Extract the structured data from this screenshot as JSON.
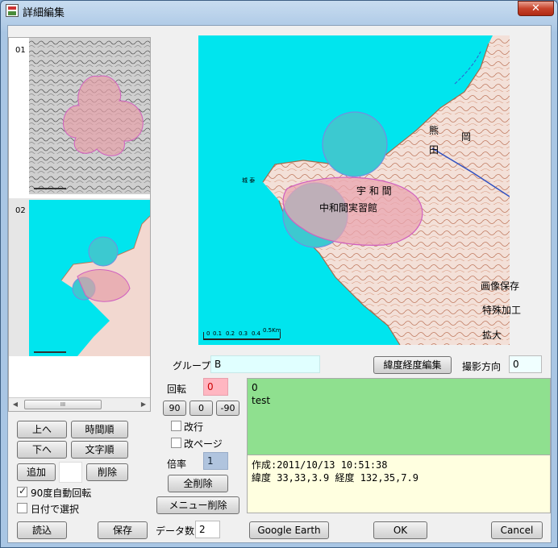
{
  "window": {
    "title": "詳細編集",
    "close_label": "✕"
  },
  "thumbnails": [
    {
      "number": "01"
    },
    {
      "number": "02"
    }
  ],
  "scrollbar": {
    "left_arrow": "◀",
    "right_arrow": "▶",
    "grip": "III"
  },
  "map": {
    "scale_ticks": [
      "0",
      "0.1",
      "0.2",
      "0.3",
      "0.4",
      "0.5Km"
    ],
    "labels": [
      "熊",
      "田",
      "岡",
      "宇 和 間",
      "中和間実習館",
      "城 泰"
    ],
    "side_buttons": {
      "save_image": "画像保存",
      "special_process": "特殊加工",
      "enlarge": "拡大"
    }
  },
  "left_buttons": {
    "up": "上へ",
    "time_order": "時間順",
    "down": "下へ",
    "text_order": "文字順",
    "add": "追加",
    "delete": "削除",
    "auto_rotate": "90度自動回転",
    "select_by_date": "日付で選択"
  },
  "group": {
    "label": "グループ",
    "value": "B"
  },
  "rotation": {
    "label": "回転",
    "value": "0",
    "btn_90": "90",
    "btn_0": "0",
    "btn_neg90": "-90"
  },
  "options": {
    "line_break": "改行",
    "page_break": "改ページ"
  },
  "scale": {
    "label": "倍率",
    "value": "1"
  },
  "delete_all": "全削除",
  "delete_menu": "メニュー削除",
  "coord_edit": "緯度経度編集",
  "shot_direction": {
    "label": "撮影方向",
    "value": "0"
  },
  "memo": {
    "line1": "0",
    "line2": "test"
  },
  "info": {
    "created": "作成:2011/10/13 10:51:38",
    "coords": "緯度 33,33,3.9 経度 132,35,7.9"
  },
  "bottom": {
    "load": "読込",
    "save": "保存",
    "data_count_label": "データ数",
    "data_count": "2",
    "google_earth": "Google Earth",
    "ok": "OK",
    "cancel": "Cancel"
  },
  "colors": {
    "map_water": "#00e5ee",
    "memo_green": "#8fe08f",
    "memo_yellow": "#ffffe0",
    "rotation_field": "#ffb6c1",
    "scale_field": "#b0c4de",
    "group_field": "#e0ffff"
  },
  "icons": [
    "app-icon",
    "close-icon",
    "checkbox-checked",
    "checkbox-unchecked",
    "scroll-left-icon",
    "scroll-right-icon"
  ]
}
